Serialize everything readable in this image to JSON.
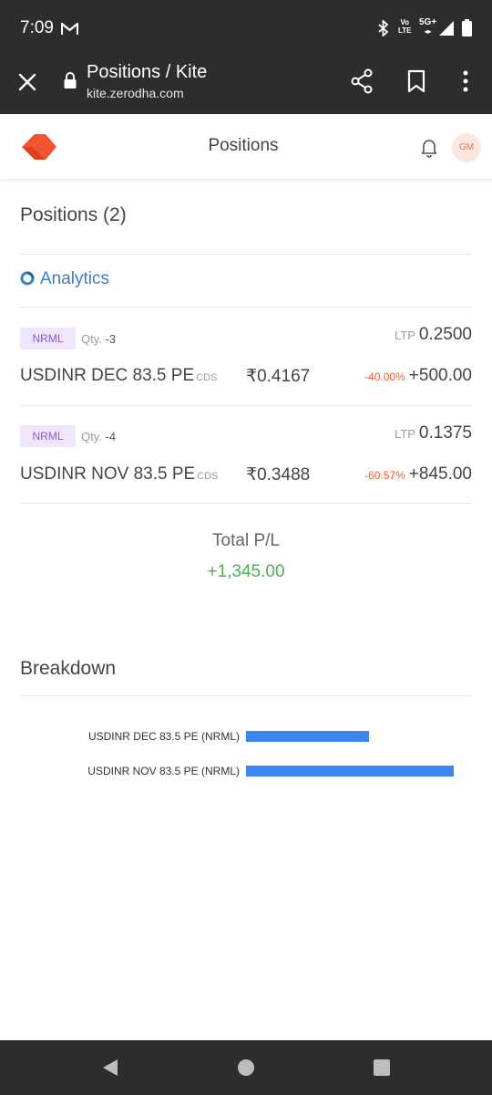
{
  "status_bar": {
    "time": "7:09",
    "network_line1": "Vo",
    "network_line2": "LTE",
    "network_5g": "5G+",
    "icons": [
      "gmail-icon",
      "bluetooth-icon",
      "signal-icon",
      "battery-icon"
    ]
  },
  "browser": {
    "title": "Positions / Kite",
    "url": "kite.zerodha.com",
    "icons": [
      "close-icon",
      "lock-icon",
      "share-icon",
      "bookmark-icon",
      "more-vert-icon"
    ]
  },
  "header": {
    "title": "Positions",
    "avatar_initials": "GM",
    "icons": [
      "kite-logo",
      "bell-icon"
    ]
  },
  "positions": {
    "heading": "Positions (2)",
    "analytics_label": "Analytics",
    "items": [
      {
        "product": "NRML",
        "qty_label": "Qty.",
        "qty": "-3",
        "ltp_label": "LTP",
        "ltp": "0.2500",
        "instrument": "USDINR DEC 83.5 PE",
        "exchange": "CDS",
        "avg_price": "₹0.4167",
        "change_pct": "-40.00%",
        "pnl": "+500.00"
      },
      {
        "product": "NRML",
        "qty_label": "Qty.",
        "qty": "-4",
        "ltp_label": "LTP",
        "ltp": "0.1375",
        "instrument": "USDINR NOV 83.5 PE",
        "exchange": "CDS",
        "avg_price": "₹0.3488",
        "change_pct": "-60.57%",
        "pnl": "+845.00"
      }
    ],
    "total_label": "Total P/L",
    "total_value": "+1,345.00"
  },
  "breakdown": {
    "heading": "Breakdown"
  },
  "chart_data": {
    "type": "bar",
    "orientation": "horizontal",
    "categories": [
      "USDINR DEC 83.5 PE (NRML)",
      "USDINR NOV 83.5 PE (NRML)"
    ],
    "values": [
      500,
      845
    ],
    "grid": false,
    "color": "#3d86f2"
  },
  "colors": {
    "accent_blue": "#387ed1",
    "profit_green": "#4caf50",
    "loss_red": "#ff5722",
    "tag_bg": "#eee7fb",
    "tag_text": "#8e56d6",
    "bar_blue": "#3d86f2",
    "kite_orange": "#f2542d"
  }
}
